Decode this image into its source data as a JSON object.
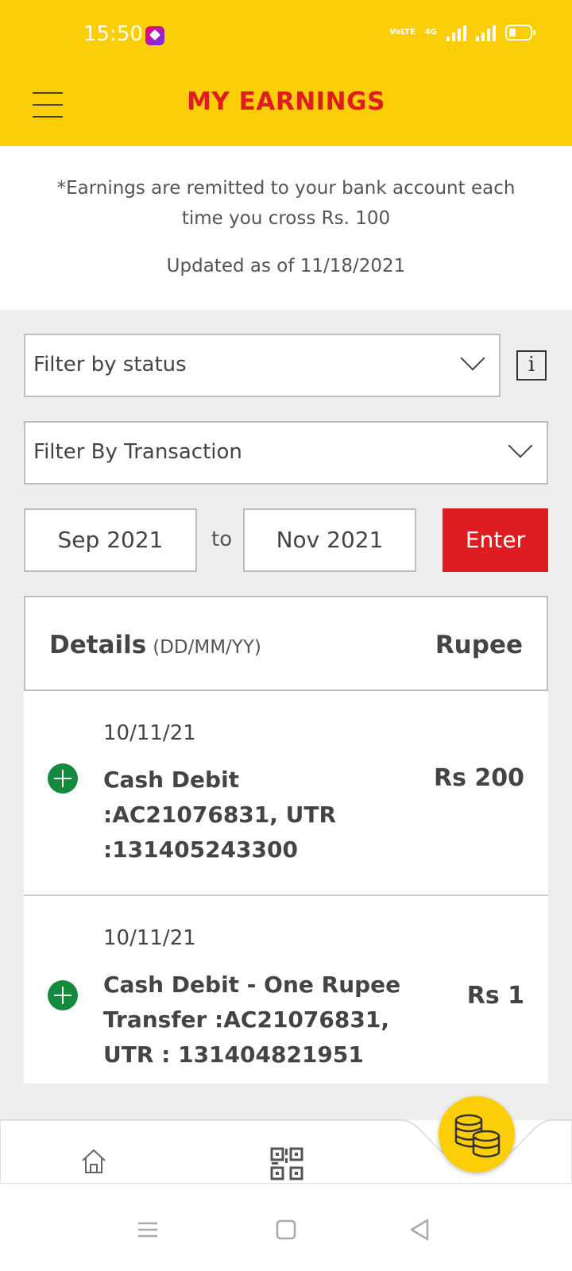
{
  "status_bar": {
    "time": "15:50",
    "network_label": "VoLTE",
    "network_type": "4G"
  },
  "header": {
    "title": "MY EARNINGS",
    "menu_icon": "hamburger-menu-icon",
    "background_color": "#FBCE07",
    "title_color": "#DD1D21"
  },
  "info": {
    "remit_note": "*Earnings are remitted to your bank account each time you cross Rs. 100",
    "updated_note": "Updated as of 11/18/2021"
  },
  "filters": {
    "status_placeholder": "Filter by status",
    "transaction_placeholder": "Filter By Transaction",
    "info_icon": "info-icon",
    "from_month": "Sep 2021",
    "to_label": "to",
    "to_month": "Nov 2021",
    "enter_label": "Enter"
  },
  "details": {
    "title": "Details",
    "date_format": "(DD/MM/YY)",
    "amount_header": "Rupee"
  },
  "transactions": [
    {
      "date": "10/11/21",
      "description": "Cash Debit :AC21076831, UTR :131405243300",
      "amount": "Rs 200",
      "icon": "plus-circle-icon"
    },
    {
      "date": "10/11/21",
      "description": "Cash Debit - One Rupee Transfer :AC21076831, UTR : 131404821951",
      "amount": "Rs 1",
      "icon": "plus-circle-icon"
    }
  ],
  "bottom_nav": {
    "items": [
      "home-icon",
      "qr-code-icon",
      "coins-icon"
    ]
  },
  "system_nav": {
    "items": [
      "menu-icon",
      "home-square-icon",
      "back-triangle-icon"
    ]
  }
}
